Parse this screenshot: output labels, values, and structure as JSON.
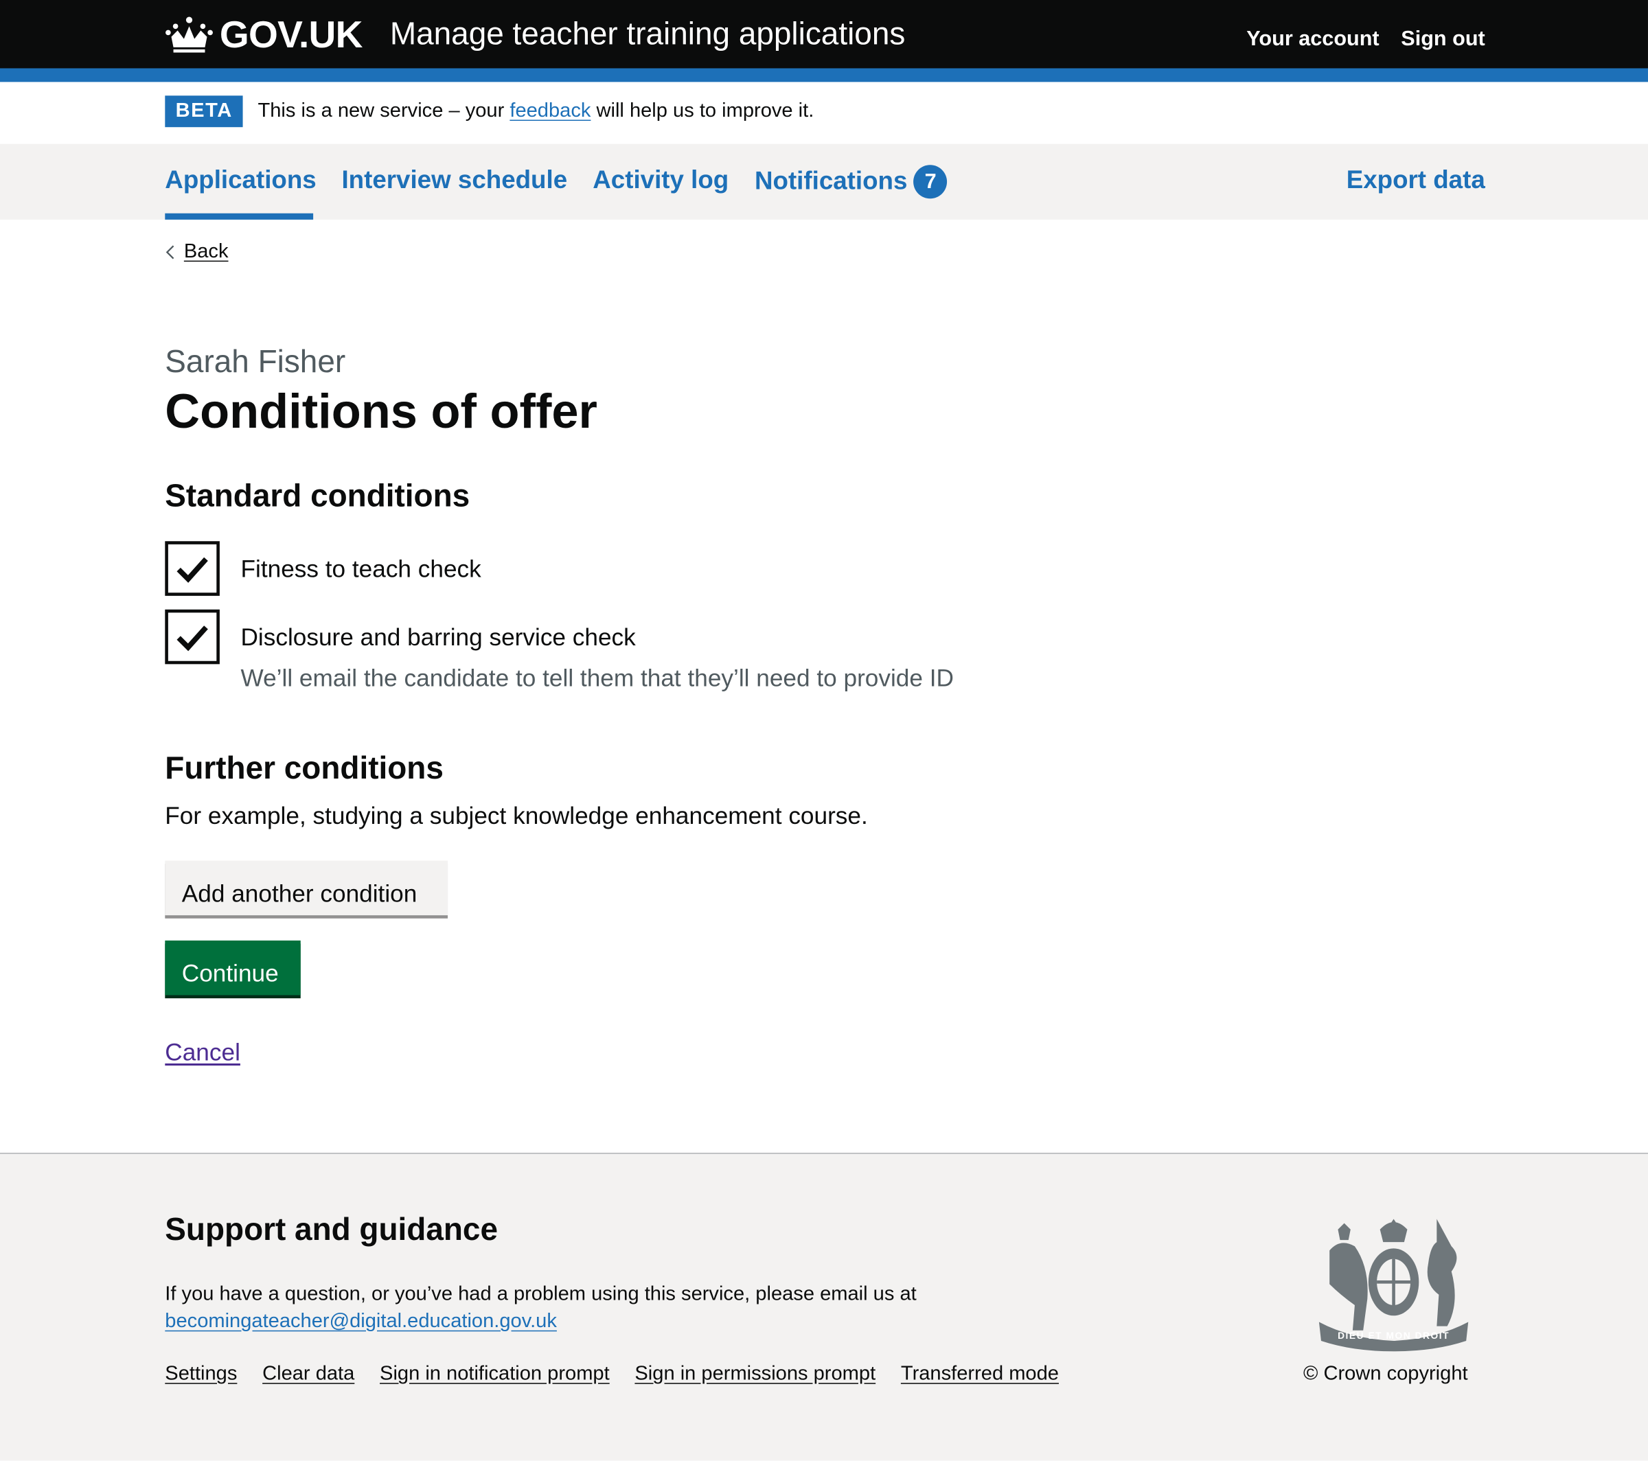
{
  "header": {
    "logo": "GOV.UK",
    "service_name": "Manage teacher training applications",
    "your_account": "Your account",
    "sign_out": "Sign out"
  },
  "phase_banner": {
    "tag": "BETA",
    "text_before": "This is a new service – your",
    "link": "feedback",
    "text_after": "will help us to improve it."
  },
  "nav": {
    "items": [
      {
        "label": "Applications",
        "active": true
      },
      {
        "label": "Interview schedule"
      },
      {
        "label": "Activity log"
      },
      {
        "label": "Notifications",
        "badge": "7"
      }
    ],
    "export": "Export data"
  },
  "back": "Back",
  "caption": "Sarah Fisher",
  "title": "Conditions of offer",
  "standard": {
    "heading": "Standard conditions",
    "items": [
      {
        "label": "Fitness to teach check",
        "checked": true
      },
      {
        "label": "Disclosure and barring service check",
        "checked": true,
        "hint": "We’ll email the candidate to tell them that they’ll need to provide ID"
      }
    ]
  },
  "further": {
    "heading": "Further conditions",
    "body": "For example, studying a subject knowledge enhancement course.",
    "add_button": "Add another condition"
  },
  "continue": "Continue",
  "cancel": "Cancel",
  "colors": {
    "brand": "#1d70b8",
    "button_green": "#00703c",
    "header": "#0b0c0c"
  },
  "footer": {
    "heading": "Support and guidance",
    "text": "If you have a question, or you’ve had a problem using this service, please email us at",
    "email": "becomingateacher@digital.education.gov.uk",
    "links": [
      "Settings",
      "Clear data",
      "Sign in notification prompt",
      "Sign in permissions prompt",
      "Transferred mode"
    ],
    "crest_motto": "DIEU ET MON DROIT",
    "copyright": "© Crown copyright"
  }
}
